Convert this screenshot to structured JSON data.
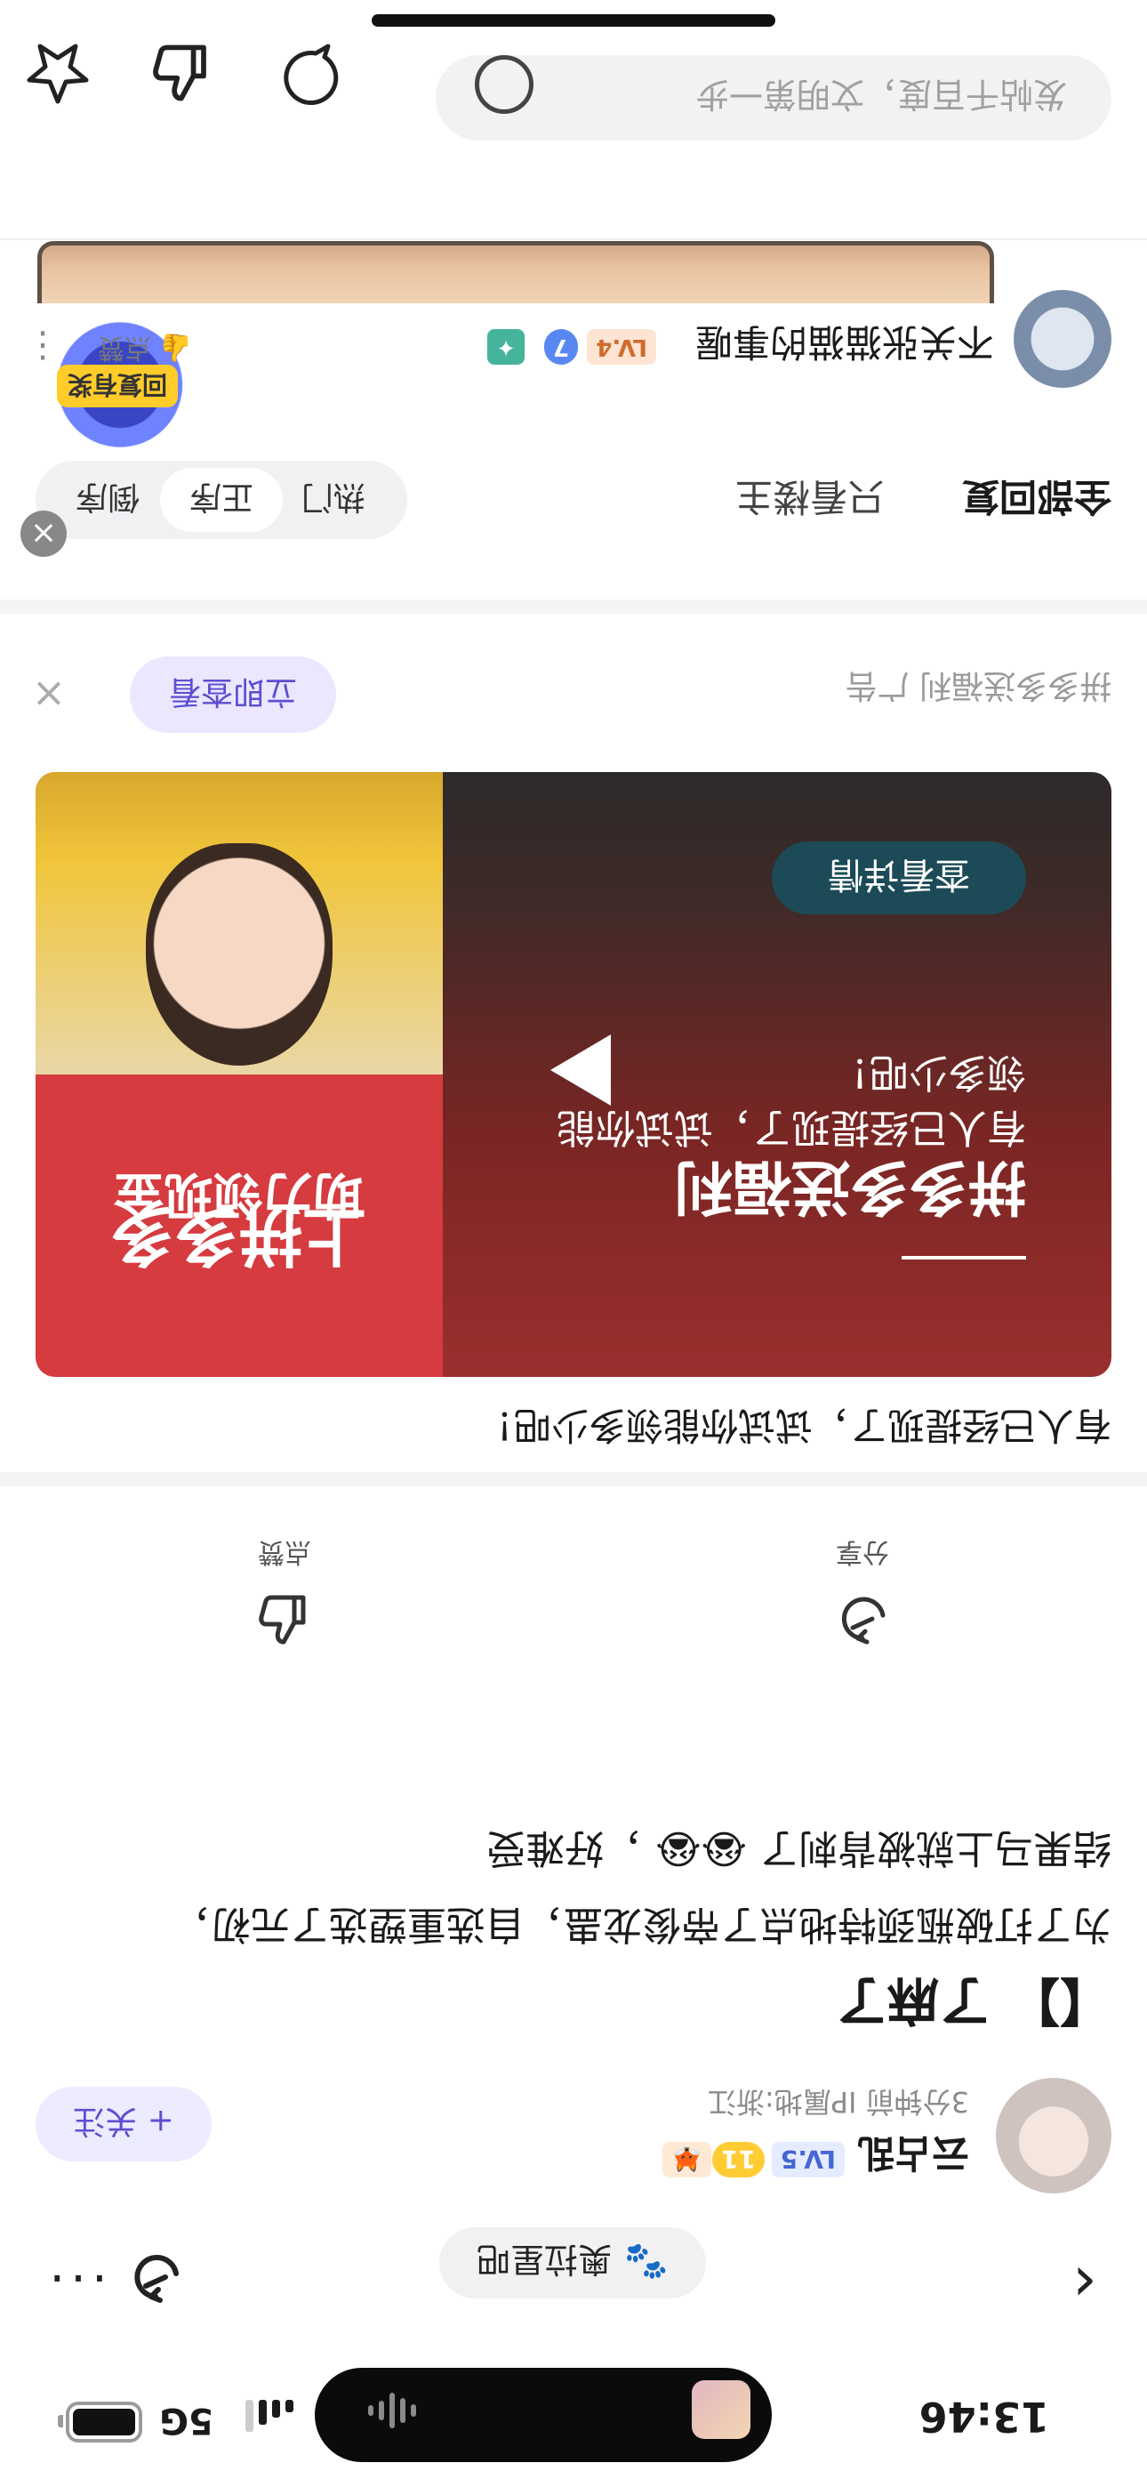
{
  "status": {
    "time": "13:46",
    "network": "5G"
  },
  "top": {
    "back": "‹",
    "topic_tag": "奥拉星吧",
    "more": "···"
  },
  "author": {
    "name": "云占乱",
    "level": "LV.5",
    "badge_num": "11",
    "meta": "3分钟前  IP属地:浙江",
    "follow": "+ 关注"
  },
  "post": {
    "title": "【】 了麻了",
    "body_line1": "为了打破瓶颈特地点了帝俊龙蛊，自选重塑选了元初，",
    "body_line2": "结果马上就被背刺了",
    "body_line2_tail": "，好难受"
  },
  "actions": {
    "share": "分享",
    "like": "点赞"
  },
  "ad": {
    "headline": "有人已经提现了，试试你能领多少吧！",
    "img_title": "拼多多送福利",
    "img_sub": "有人已经提现了，试试你能领多少吧！",
    "img_btn": "查看详情",
    "right_big1": "上拼多多",
    "right_big2": "助力领现金",
    "brand": "拼多多送福利  广告",
    "cta": "立即查看",
    "close": "×"
  },
  "comments_tabs": {
    "all": "全部回复",
    "owner": "只看楼主",
    "seg": [
      "热门",
      "正序",
      "倒序"
    ],
    "active_seg": "正序"
  },
  "redpacket": {
    "label": "回复有奖"
  },
  "comment": {
    "name": "不关张猫猫的事喔",
    "level": "LV.4",
    "badge_num": "7",
    "like": "点赞",
    "more": "⋮"
  },
  "input": {
    "placeholder": "发帖千百度，文明第一步"
  }
}
